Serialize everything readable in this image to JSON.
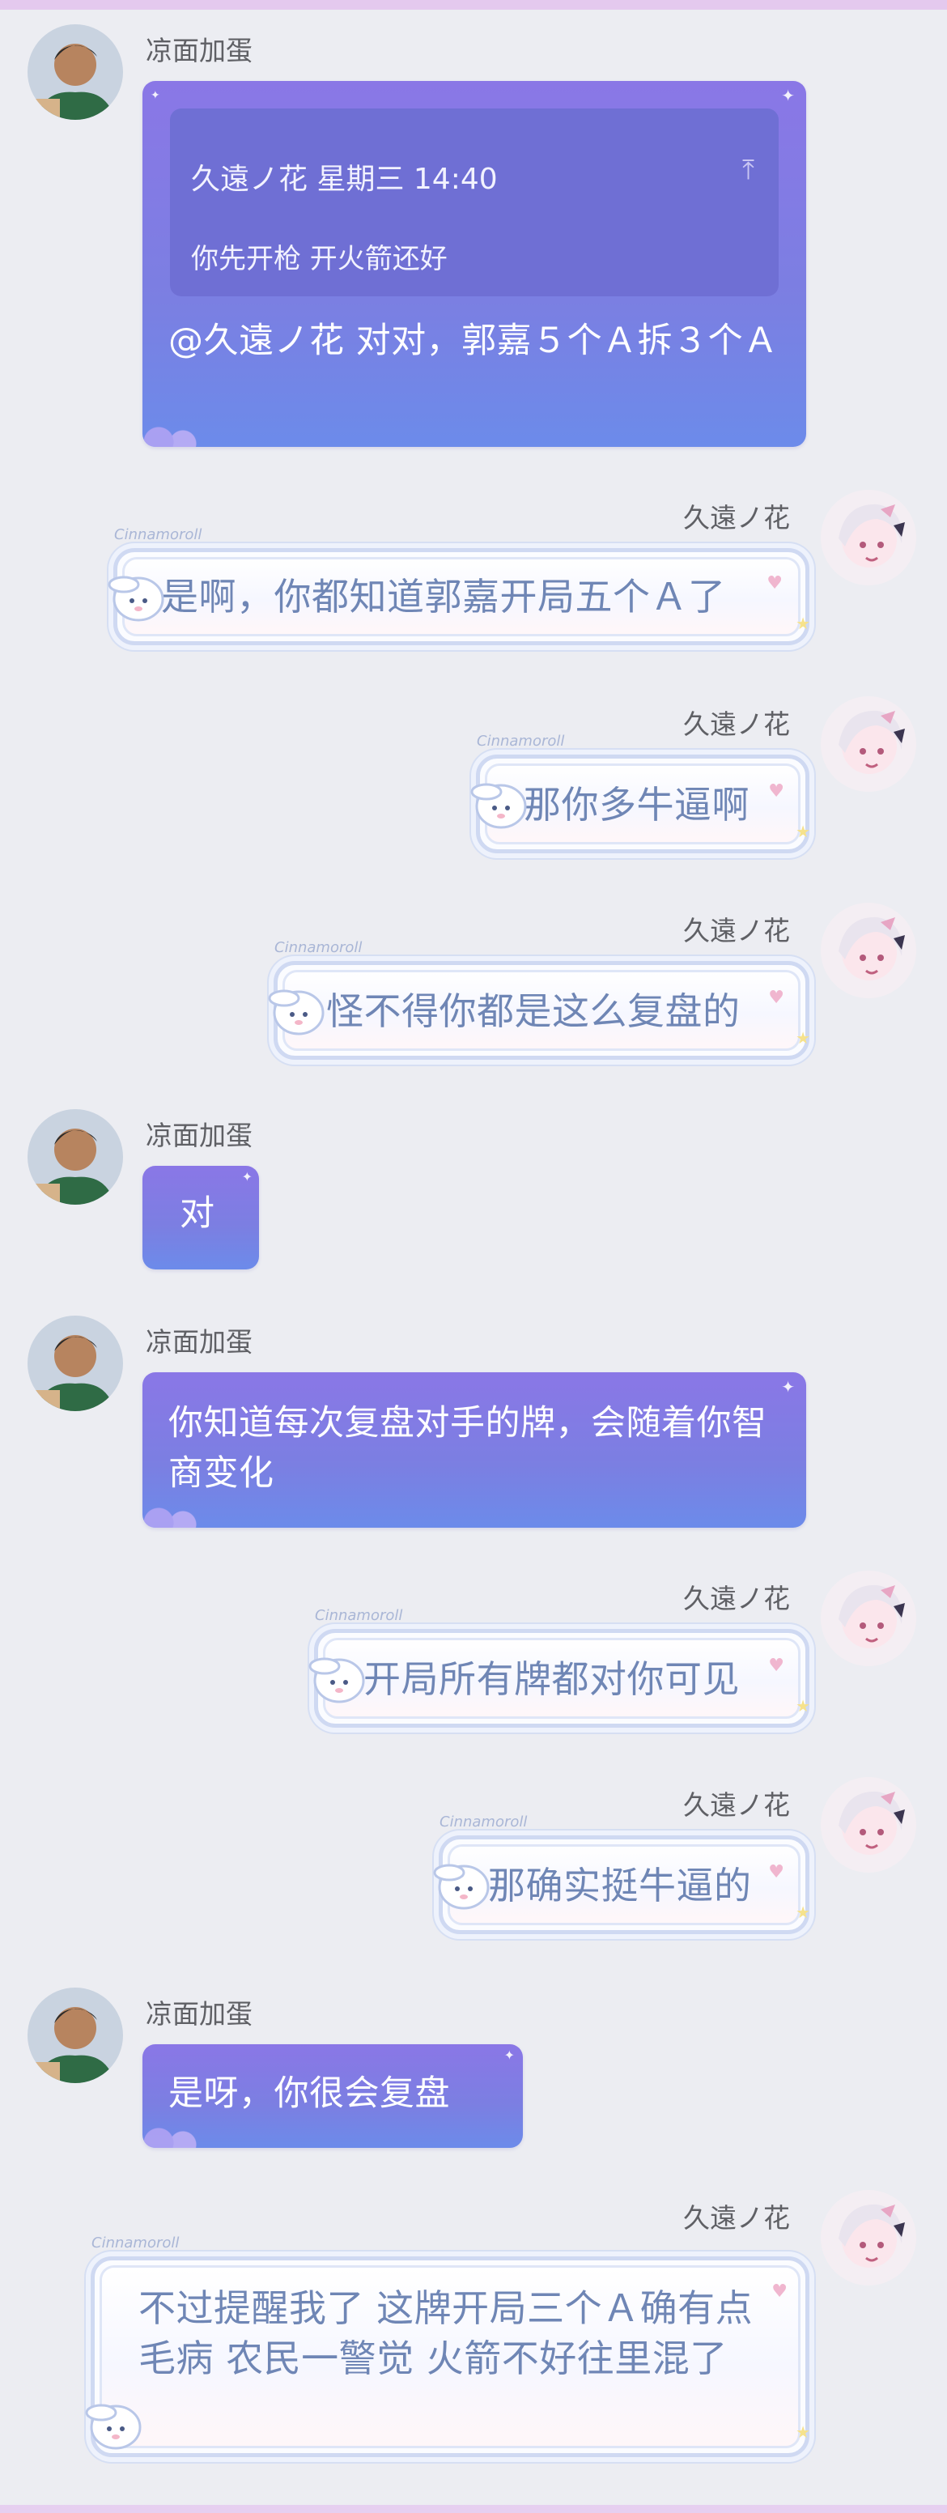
{
  "users": {
    "left": {
      "name": "凉面加蛋"
    },
    "right": {
      "name": "久遠ノ花"
    }
  },
  "decoration": {
    "bubble_tag": "Cinnamoroll"
  },
  "messages": [
    {
      "id": "m1",
      "sender": "凉面加蛋",
      "quote": {
        "header": "久遠ノ花 星期三 14:40",
        "text": "你先开枪 开火箭还好",
        "icon": "arrow-up-to-top-icon"
      },
      "text": "@久遠ノ花 对对，郭嘉５个Ａ拆３个Ａ"
    },
    {
      "id": "m2",
      "sender": "久遠ノ花",
      "text": "是啊，你都知道郭嘉开局五个Ａ了"
    },
    {
      "id": "m3",
      "sender": "久遠ノ花",
      "text": "那你多牛逼啊"
    },
    {
      "id": "m4",
      "sender": "久遠ノ花",
      "text": "怪不得你都是这么复盘的"
    },
    {
      "id": "m5",
      "sender": "凉面加蛋",
      "text": "对"
    },
    {
      "id": "m6",
      "sender": "凉面加蛋",
      "text": "你知道每次复盘对手的牌，会随着你智商变化"
    },
    {
      "id": "m7",
      "sender": "久遠ノ花",
      "text": "开局所有牌都对你可见"
    },
    {
      "id": "m8",
      "sender": "久遠ノ花",
      "text": "那确实挺牛逼的"
    },
    {
      "id": "m9",
      "sender": "凉面加蛋",
      "text": "是呀，你很会复盘"
    },
    {
      "id": "m10",
      "sender": "久遠ノ花",
      "text": "不过提醒我了 这牌开局三个Ａ确有点毛病 农民一警觉 火箭不好往里混了"
    }
  ]
}
